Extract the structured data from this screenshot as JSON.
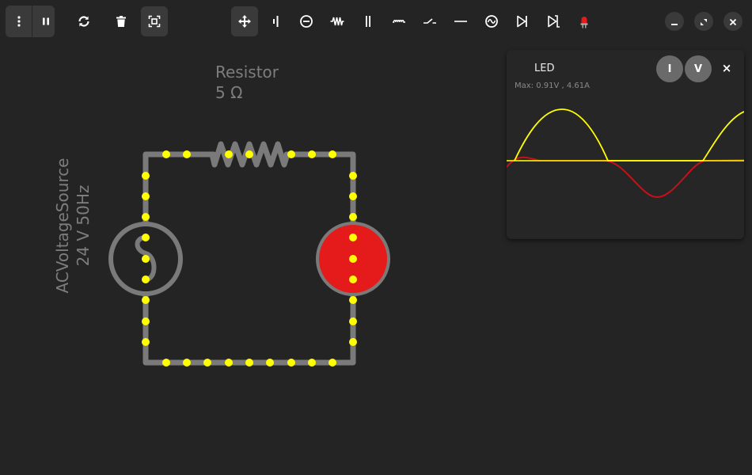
{
  "toolbar": {
    "left": [
      {
        "name": "more-icon",
        "active": false
      },
      {
        "name": "pause-icon",
        "active": false
      },
      {
        "name": "reset-icon",
        "active": false
      },
      {
        "name": "delete-icon",
        "active": false
      },
      {
        "name": "screenshot-icon",
        "active": true
      }
    ],
    "tools": [
      {
        "name": "move-tool-icon",
        "active": true
      },
      {
        "name": "battery-tool-icon",
        "active": false
      },
      {
        "name": "current-source-tool-icon",
        "active": false
      },
      {
        "name": "resistor-tool-icon",
        "active": false
      },
      {
        "name": "capacitor-tool-icon",
        "active": false
      },
      {
        "name": "inductor-tool-icon",
        "active": false
      },
      {
        "name": "switch-tool-icon",
        "active": false
      },
      {
        "name": "wire-tool-icon",
        "active": false
      },
      {
        "name": "ac-source-tool-icon",
        "active": false
      },
      {
        "name": "diode-tool-icon",
        "active": false
      },
      {
        "name": "zener-diode-tool-icon",
        "active": false
      },
      {
        "name": "led-tool-icon",
        "active": false
      }
    ],
    "window": [
      "minimize-icon",
      "restore-icon",
      "close-icon"
    ]
  },
  "circuit": {
    "resistor": {
      "label": "Resistor",
      "value": "5 Ω"
    },
    "source": {
      "label": "ACVoltageSource",
      "value": "24 V 50Hz"
    },
    "led": {
      "color": "#e51a1a"
    },
    "wire_color": "#7a7a7a",
    "electron_color": "#ffff00"
  },
  "oscilloscope": {
    "title": "LED",
    "info": "Max: 0.91V , 4.61A",
    "current_button": "I",
    "voltage_button": "V",
    "close": "×",
    "colors": {
      "voltage": "#ffff00",
      "current": "#c8101a",
      "baseline": "#8a6a6a"
    }
  }
}
